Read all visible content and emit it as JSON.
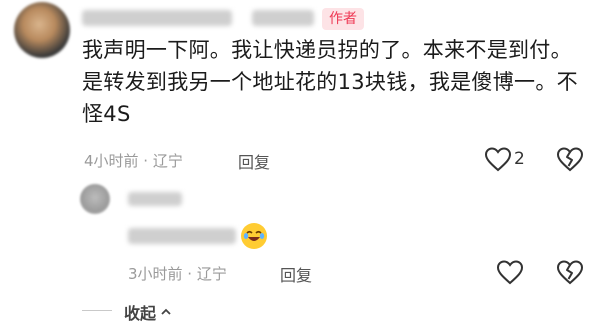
{
  "comment": {
    "author_badge": "作者",
    "text": "我声明一下阿。我让快递员拐的了。本来不是到付。是转发到我另一个地址花的13块钱，我是傻博一。不怪4S",
    "time_location": "4小时前 · 辽宁",
    "reply_label": "回复",
    "like_count": "2"
  },
  "reply": {
    "time_location": "3小时前 · 辽宁",
    "reply_label": "回复"
  },
  "collapse_label": "收起",
  "collapse_icon": "chevron-up-icon",
  "colors": {
    "badge_text": "#ee3a55",
    "badge_bg": "#fde3e6",
    "meta_text": "#9a9a9a"
  }
}
